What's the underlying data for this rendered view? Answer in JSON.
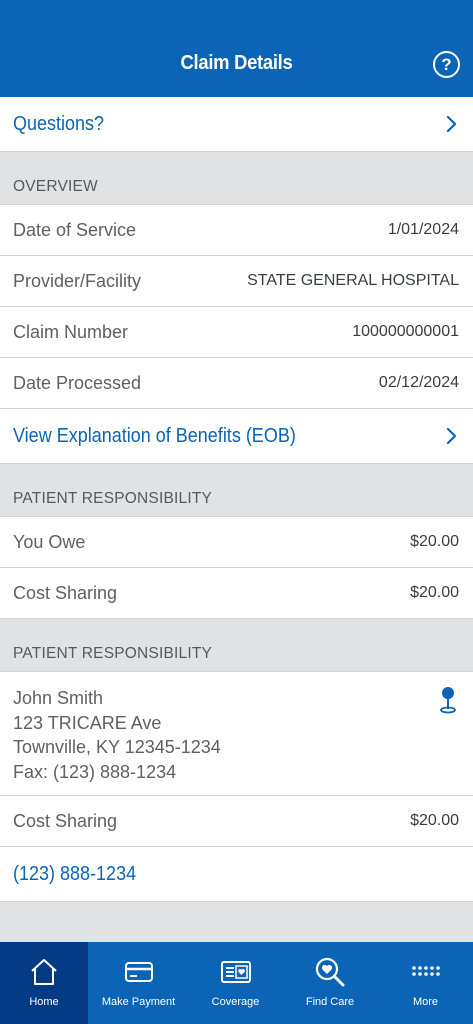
{
  "header": {
    "title": "Claim Details"
  },
  "questions_link": {
    "label": "Questions?"
  },
  "overview": {
    "heading": "OVERVIEW",
    "rows": [
      {
        "label": "Date of Service",
        "value": "1/01/2024"
      },
      {
        "label": "Provider/Facility",
        "value": "STATE GENERAL HOSPITAL"
      },
      {
        "label": "Claim Number",
        "value": "100000000001"
      },
      {
        "label": "Date Processed",
        "value": "02/12/2024"
      }
    ]
  },
  "eob_link": {
    "label": "View Explanation of Benefits (EOB)"
  },
  "patient_responsibility": {
    "heading": "PATIENT RESPONSIBILITY",
    "rows": [
      {
        "label": "You Owe",
        "value": "$20.00"
      },
      {
        "label": "Cost Sharing",
        "value": "$20.00"
      }
    ]
  },
  "patient_responsibility_2": {
    "heading": "PATIENT RESPONSIBILITY",
    "address": {
      "name": "John Smith",
      "street": "123 TRICARE Ave",
      "city_state_zip": "Townville, KY 12345-1234",
      "fax": "Fax: (123) 888-1234"
    },
    "cost_sharing": {
      "label": "Cost Sharing",
      "value": "$20.00"
    },
    "phone": "(123) 888-1234"
  },
  "tabbar": {
    "tabs": [
      {
        "label": "Home",
        "icon": "home-icon"
      },
      {
        "label": "Make Payment",
        "icon": "credit-card-icon"
      },
      {
        "label": "Coverage",
        "icon": "coverage-card-icon"
      },
      {
        "label": "Find Care",
        "icon": "search-heart-icon"
      },
      {
        "label": "More",
        "icon": "grid-dots-icon"
      }
    ]
  },
  "colors": {
    "brand_blue": "#0b64b5",
    "active_tab": "#053a85",
    "section_gray": "#e1e2e4"
  }
}
